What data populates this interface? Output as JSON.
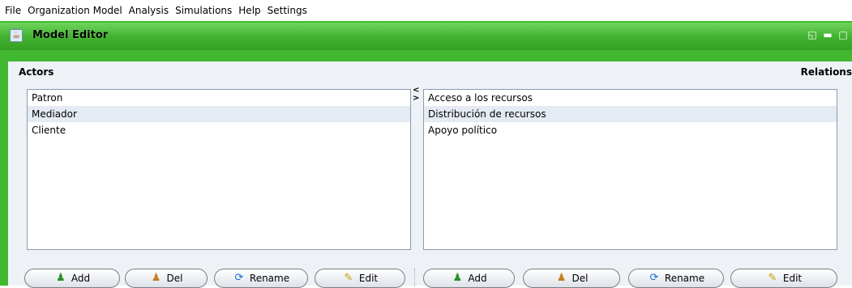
{
  "menu": [
    "File",
    "Organization Model",
    "Analysis",
    "Simulations",
    "Help",
    "Settings"
  ],
  "window": {
    "title": "Model Editor"
  },
  "actors": {
    "heading": "Actors",
    "items": [
      "Patron",
      "Mediador",
      "Cliente"
    ]
  },
  "relations": {
    "heading": "Relations",
    "items": [
      "Acceso a los recursos",
      "Distribución de recursos",
      "Apoyo político"
    ]
  },
  "buttons": {
    "add": "Add",
    "del": "Del",
    "rename": "Rename",
    "edit": "Edit"
  },
  "colors": {
    "frame": "#42b830",
    "panel": "#eef2f7"
  }
}
